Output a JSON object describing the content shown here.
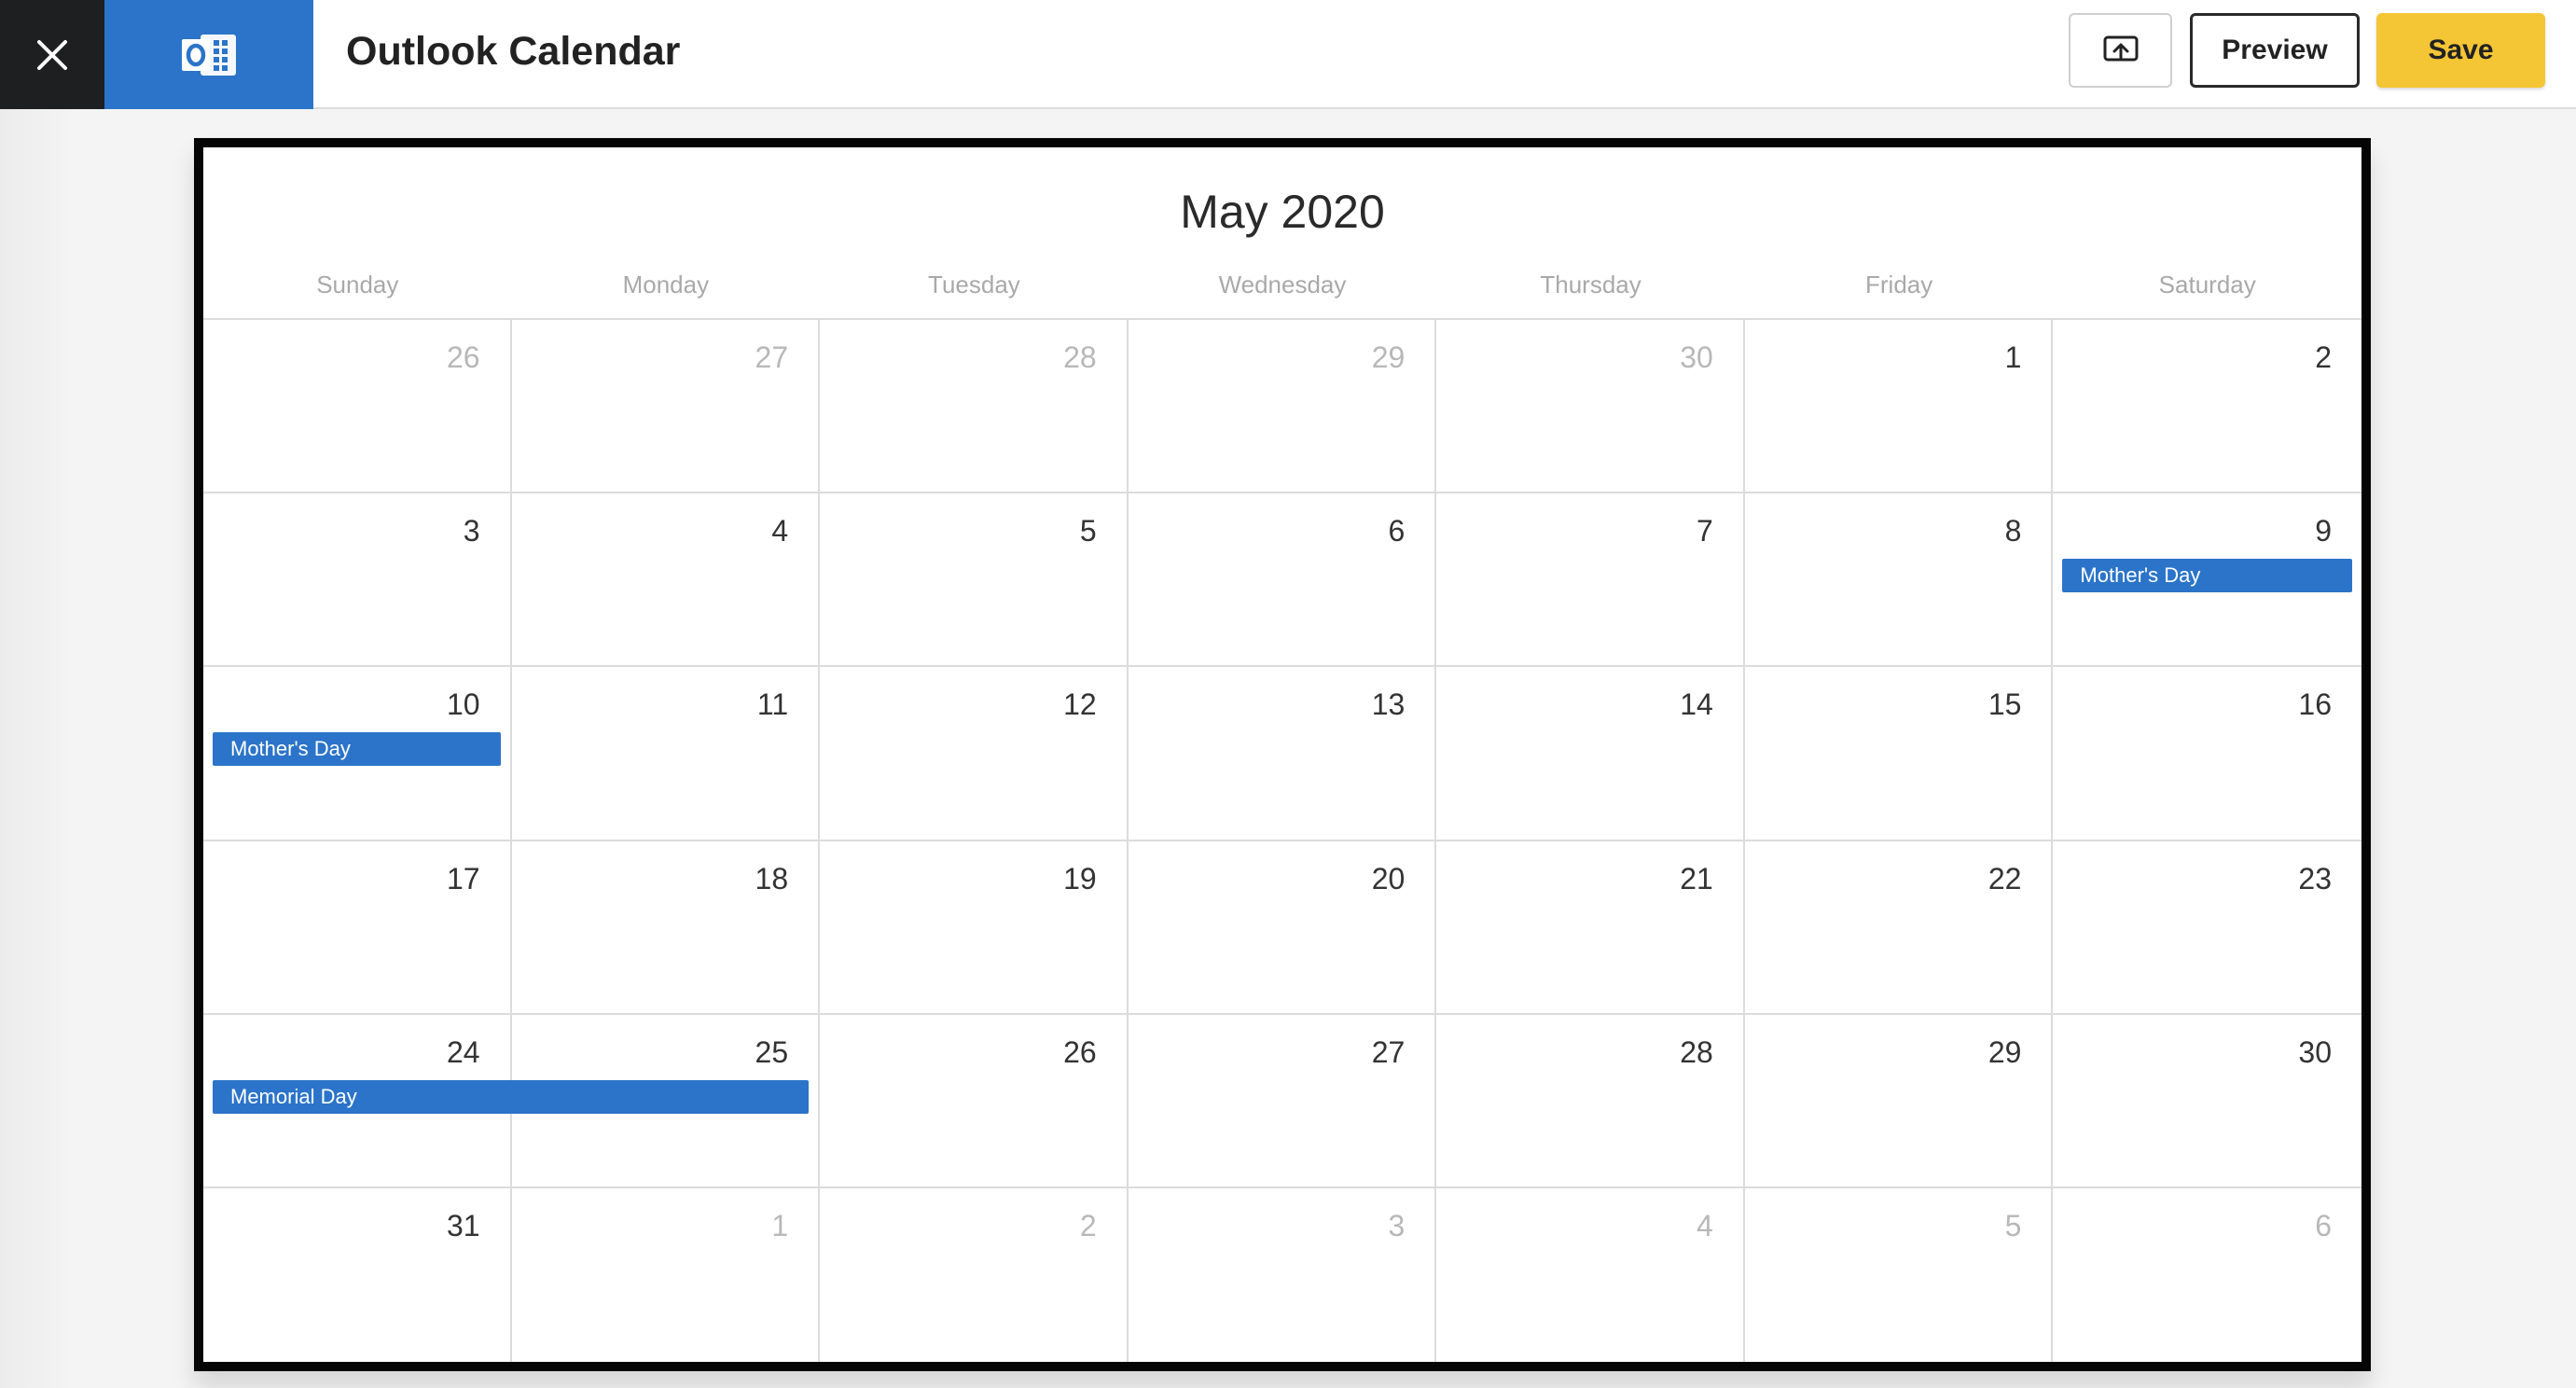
{
  "header": {
    "app_title": "Outlook Calendar",
    "app_icon": "outlook-icon",
    "close_icon": "close-icon",
    "publish_icon": "screen-upload-icon",
    "preview_label": "Preview",
    "save_label": "Save"
  },
  "calendar": {
    "month_title": "May 2020",
    "weekdays": [
      "Sunday",
      "Monday",
      "Tuesday",
      "Wednesday",
      "Thursday",
      "Friday",
      "Saturday"
    ],
    "days": [
      {
        "n": "26",
        "muted": true
      },
      {
        "n": "27",
        "muted": true
      },
      {
        "n": "28",
        "muted": true
      },
      {
        "n": "29",
        "muted": true
      },
      {
        "n": "30",
        "muted": true
      },
      {
        "n": "1",
        "muted": false
      },
      {
        "n": "2",
        "muted": false
      },
      {
        "n": "3",
        "muted": false
      },
      {
        "n": "4",
        "muted": false
      },
      {
        "n": "5",
        "muted": false
      },
      {
        "n": "6",
        "muted": false
      },
      {
        "n": "7",
        "muted": false
      },
      {
        "n": "8",
        "muted": false
      },
      {
        "n": "9",
        "muted": false
      },
      {
        "n": "10",
        "muted": false
      },
      {
        "n": "11",
        "muted": false
      },
      {
        "n": "12",
        "muted": false
      },
      {
        "n": "13",
        "muted": false
      },
      {
        "n": "14",
        "muted": false
      },
      {
        "n": "15",
        "muted": false
      },
      {
        "n": "16",
        "muted": false
      },
      {
        "n": "17",
        "muted": false
      },
      {
        "n": "18",
        "muted": false
      },
      {
        "n": "19",
        "muted": false
      },
      {
        "n": "20",
        "muted": false
      },
      {
        "n": "21",
        "muted": false
      },
      {
        "n": "22",
        "muted": false
      },
      {
        "n": "23",
        "muted": false
      },
      {
        "n": "24",
        "muted": false
      },
      {
        "n": "25",
        "muted": false
      },
      {
        "n": "26",
        "muted": false
      },
      {
        "n": "27",
        "muted": false
      },
      {
        "n": "28",
        "muted": false
      },
      {
        "n": "29",
        "muted": false
      },
      {
        "n": "30",
        "muted": false
      },
      {
        "n": "31",
        "muted": false
      },
      {
        "n": "1",
        "muted": true
      },
      {
        "n": "2",
        "muted": true
      },
      {
        "n": "3",
        "muted": true
      },
      {
        "n": "4",
        "muted": true
      },
      {
        "n": "5",
        "muted": true
      },
      {
        "n": "6",
        "muted": true
      }
    ],
    "events": [
      {
        "title": "Mother's Day",
        "start_index": 13,
        "span_days": 1
      },
      {
        "title": "Mother's Day",
        "start_index": 14,
        "span_days": 1
      },
      {
        "title": "Memorial Day",
        "start_index": 28,
        "span_days": 2
      }
    ]
  },
  "colors": {
    "accent_blue": "#2b74c9",
    "save_yellow": "#f4c535",
    "close_dark": "#1e1f21"
  }
}
